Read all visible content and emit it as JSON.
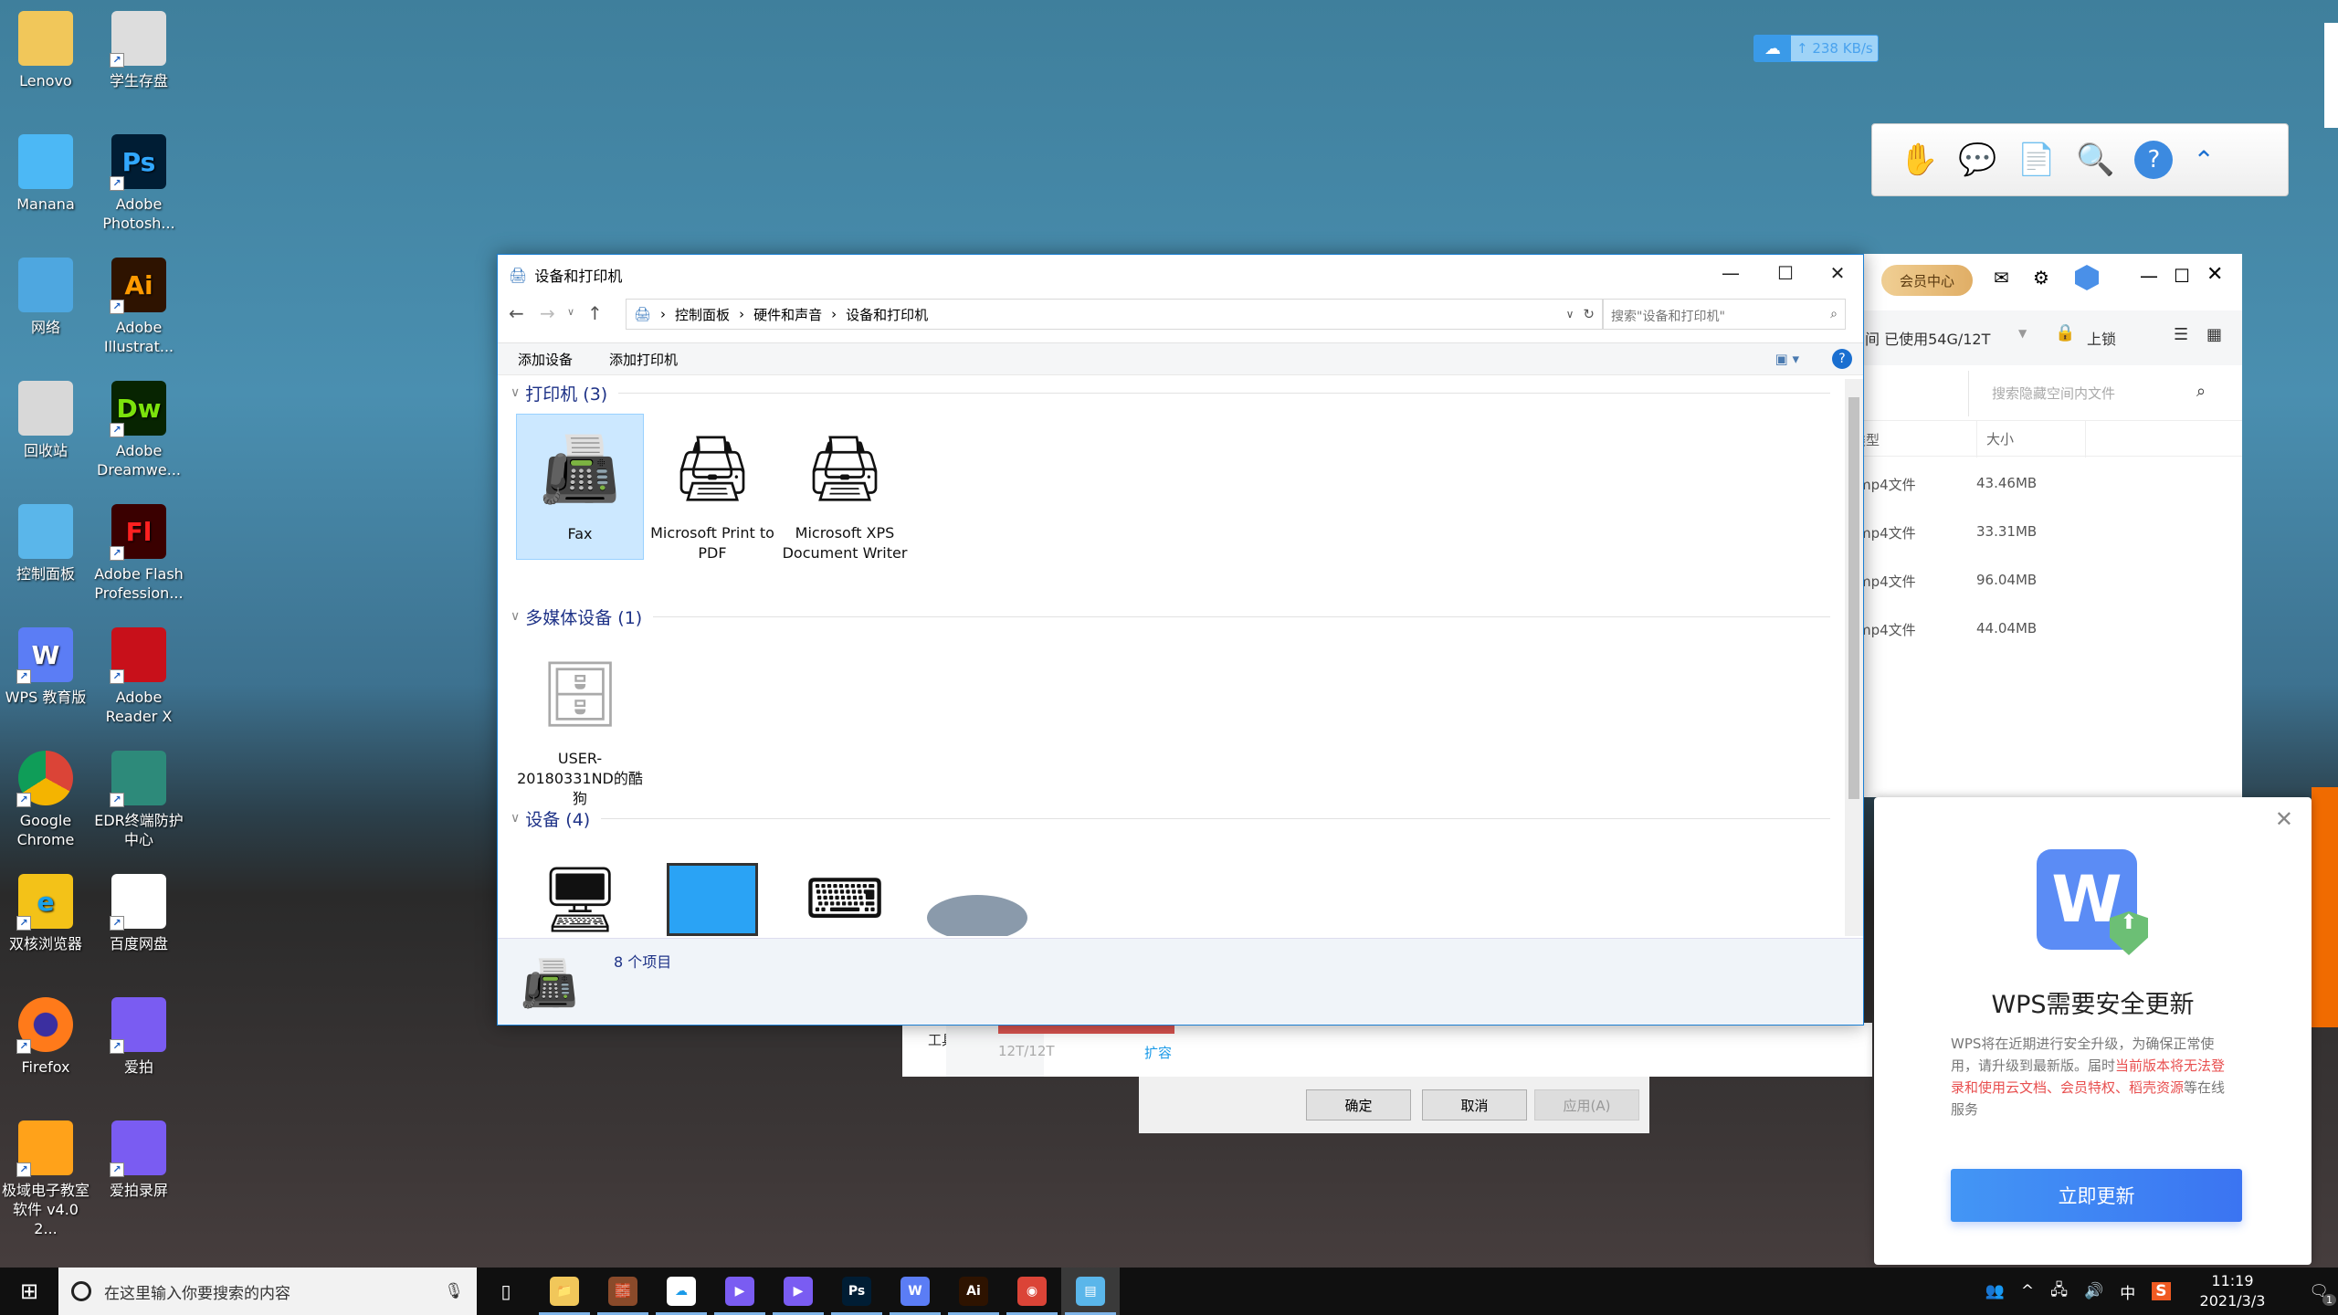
{
  "desktop": {
    "icons": [
      {
        "label": "Lenovo",
        "icon": "user-folder-icon"
      },
      {
        "label": "学生存盘",
        "icon": "drive-icon"
      },
      {
        "label": "Manana",
        "icon": "computer-icon"
      },
      {
        "label": "Adobe Photosh...",
        "icon": "photoshop-icon",
        "glyph": "Ps"
      },
      {
        "label": "网络",
        "icon": "network-icon"
      },
      {
        "label": "Adobe Illustrat...",
        "icon": "illustrator-icon",
        "glyph": "Ai"
      },
      {
        "label": "回收站",
        "icon": "recycle-bin-icon"
      },
      {
        "label": "Adobe Dreamwe...",
        "icon": "dreamweaver-icon",
        "glyph": "Dw"
      },
      {
        "label": "控制面板",
        "icon": "control-panel-icon"
      },
      {
        "label": "Adobe Flash Profession...",
        "icon": "flash-icon",
        "glyph": "Fl"
      },
      {
        "label": "WPS 教育版",
        "icon": "wps-edu-icon",
        "glyph": "W"
      },
      {
        "label": "Adobe Reader X",
        "icon": "adobe-reader-icon"
      },
      {
        "label": "Google Chrome",
        "icon": "chrome-icon"
      },
      {
        "label": "EDR终端防护中心",
        "icon": "edr-shield-icon"
      },
      {
        "label": "双核浏览器",
        "icon": "browser-e-icon",
        "glyph": "e"
      },
      {
        "label": "百度网盘",
        "icon": "baidu-netdisk-icon"
      },
      {
        "label": "Firefox",
        "icon": "firefox-icon"
      },
      {
        "label": "爱拍",
        "icon": "aipai-icon"
      },
      {
        "label": "极域电子教室软件 v4.0 2...",
        "icon": "classroom-icon"
      },
      {
        "label": "爱拍录屏",
        "icon": "aipai-recorder-icon"
      }
    ]
  },
  "netdisk_speed": "238 KB/s",
  "explorer": {
    "title": "设备和打印机",
    "breadcrumb": [
      "控制面板",
      "硬件和声音",
      "设备和打印机"
    ],
    "search_placeholder": "搜索\"设备和打印机\"",
    "commands": {
      "add_device": "添加设备",
      "add_printer": "添加打印机"
    },
    "groups": [
      {
        "label": "打印机 (3)",
        "items": [
          "Fax",
          "Microsoft Print to PDF",
          "Microsoft XPS Document Writer"
        ]
      },
      {
        "label": "多媒体设备 (1)",
        "items": [
          "USER-20180331ND的酷狗"
        ]
      },
      {
        "label": "设备 (4)",
        "items": [
          "computer",
          "monitor",
          "keyboard",
          "mouse"
        ]
      }
    ],
    "status": "8 个项目"
  },
  "baidu": {
    "vip": "会员中心",
    "usage": "间 已使用54G/12T",
    "lock": "上锁",
    "search_placeholder": "搜索隐藏空间内文件",
    "columns": [
      "类型",
      "大小"
    ],
    "rows": [
      {
        "type": "mp4文件",
        "size": "43.46MB"
      },
      {
        "type": "mp4文件",
        "size": "33.31MB"
      },
      {
        "type": "mp4文件",
        "size": "96.04MB"
      },
      {
        "type": "mp4文件",
        "size": "44.04MB"
      }
    ]
  },
  "behind": {
    "tools": "工具",
    "capacity": "12T/12T",
    "expand": "扩容"
  },
  "dialog": {
    "ok": "确定",
    "cancel": "取消",
    "apply": "应用(A)"
  },
  "wps": {
    "title": "WPS需要安全更新",
    "body_normal": "WPS将在近期进行安全升级，为确保正常使用，请升级到最新版。届时",
    "body_red": "当前版本将无法登录和使用云文档、会员特权、稻壳资源",
    "body_end": "等在线服务",
    "button": "立即更新",
    "accent": "#3b82f6"
  },
  "taskbar": {
    "search_placeholder": "在这里输入你要搜索的内容",
    "time": "11:19",
    "date": "2021/3/3",
    "ime": "中",
    "notifications": "1"
  }
}
